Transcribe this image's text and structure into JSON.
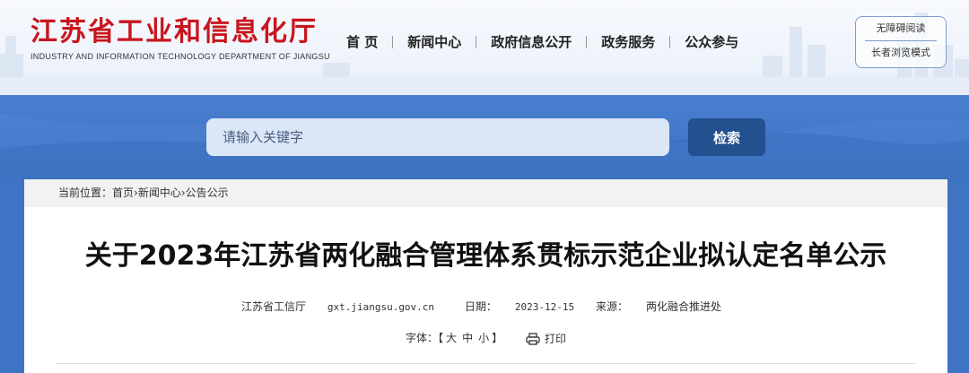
{
  "site": {
    "name_cn": "江苏省工业和信息化厅",
    "name_en": "INDUSTRY AND INFORMATION TECHNOLOGY DEPARTMENT OF JIANGSU"
  },
  "nav": {
    "items": [
      {
        "label": "首 页"
      },
      {
        "label": "新闻中心"
      },
      {
        "label": "政府信息公开"
      },
      {
        "label": "政务服务"
      },
      {
        "label": "公众参与"
      }
    ]
  },
  "accessibility": {
    "barrier_free": "无障碍阅读",
    "elderly_mode": "长者浏览模式"
  },
  "search": {
    "placeholder": "请输入关键字",
    "button_label": "检索"
  },
  "breadcrumb": {
    "prefix": "当前位置：",
    "items": [
      "首页",
      "新闻中心",
      "公告公示"
    ],
    "separator": "›"
  },
  "article": {
    "title": "关于2023年江苏省两化融合管理体系贯标示范企业拟认定名单公示",
    "publisher": "江苏省工信厅",
    "website": "gxt.jiangsu.gov.cn",
    "date_label": "日期：",
    "date": "2023-12-15",
    "source_label": "来源：",
    "source": "两化融合推进处"
  },
  "tools": {
    "font_label": "字体：",
    "bracket_open": "【",
    "size_large": "大",
    "size_medium": "中",
    "size_small": "小",
    "bracket_close": "】",
    "print_label": "打印",
    "print_icon": "printer-icon"
  },
  "colors": {
    "brand_red": "#c8161e",
    "banner_blue": "#3f73c4",
    "search_button": "#23508f"
  }
}
